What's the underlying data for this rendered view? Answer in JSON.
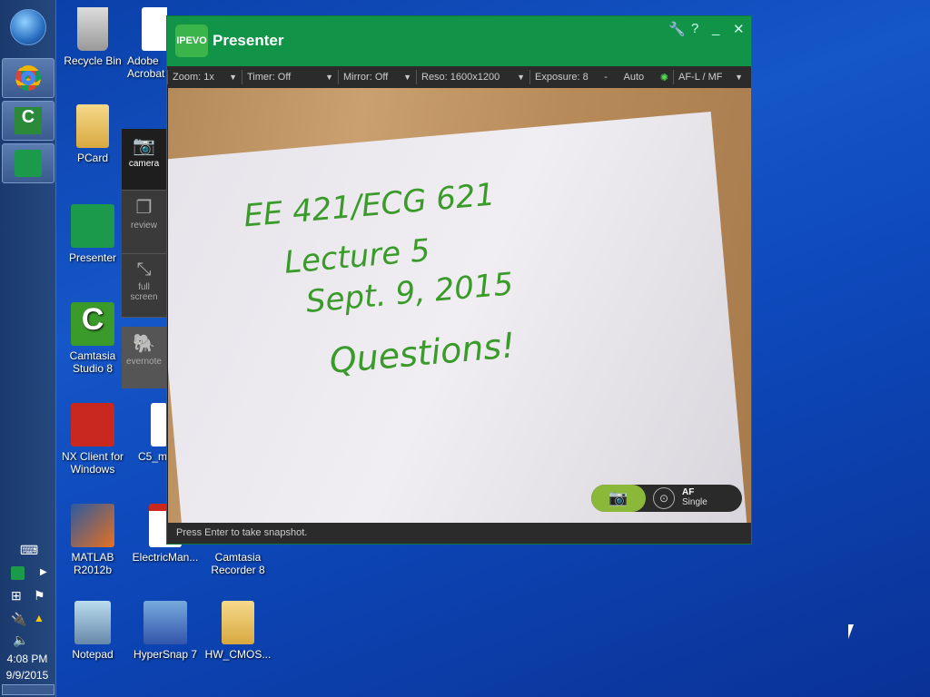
{
  "taskbar": {
    "time": "4:08 PM",
    "date": "9/9/2015"
  },
  "desktop": {
    "icons": [
      {
        "label": "Recycle Bin"
      },
      {
        "label": "Adobe Acrobat"
      },
      {
        "label": "PCard"
      },
      {
        "label": "Presenter"
      },
      {
        "label": "Camtasia Studio 8"
      },
      {
        "label": "NX Client for Windows"
      },
      {
        "label": "C5_m..."
      },
      {
        "label": "MATLAB R2012b"
      },
      {
        "label": "ElectricMan..."
      },
      {
        "label": "Camtasia Recorder 8"
      },
      {
        "label": "Notepad"
      },
      {
        "label": "HyperSnap 7"
      },
      {
        "label": "HW_CMOS..."
      }
    ]
  },
  "window": {
    "logo": "IPEVO",
    "title": "Presenter",
    "controls": {
      "settings": "🔧",
      "help": "?",
      "minimize": "_",
      "close": "✕"
    },
    "toolbar": {
      "zoom": "Zoom: 1x",
      "timer": "Timer: Off",
      "mirror": "Mirror: Off",
      "reso": "Reso: 1600x1200",
      "exposure": "Exposure: 8",
      "exposure_minus": "-",
      "auto": "Auto",
      "focus": "AF-L / MF"
    },
    "side": {
      "camera": "camera",
      "review": "review",
      "fullscreen": "full screen",
      "evernote": "evernote"
    },
    "camera_text": [
      "EE 421/ECG 621",
      "Lecture 5",
      "Sept. 9, 2015",
      "Questions!"
    ],
    "af": {
      "label": "AF",
      "mode": "Single"
    },
    "status": "Press Enter to take snapshot."
  }
}
